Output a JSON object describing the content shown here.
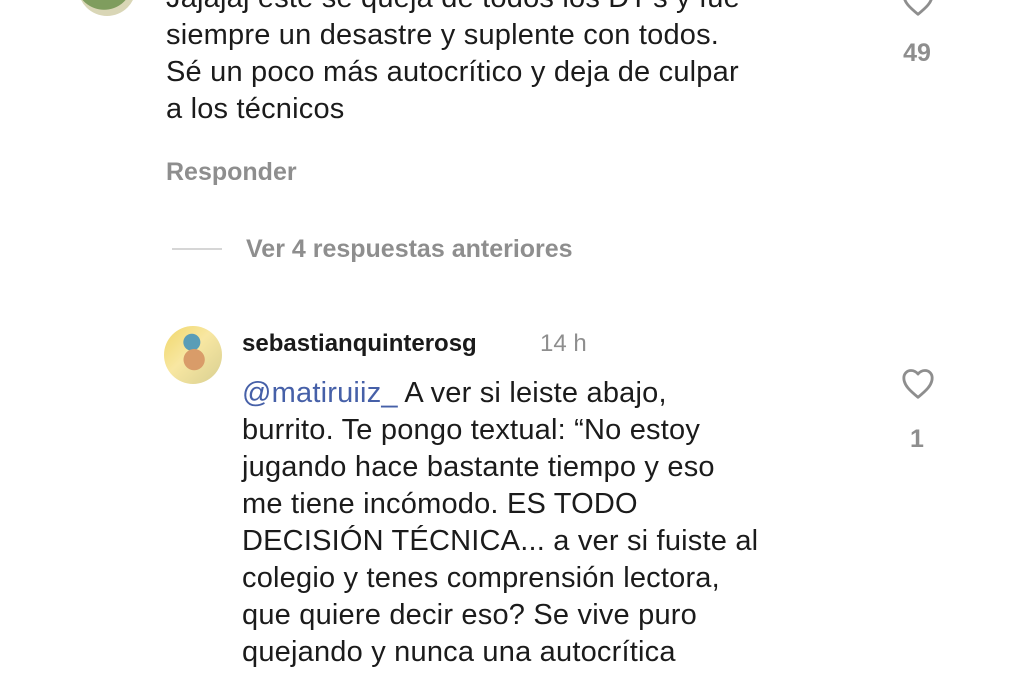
{
  "comment_top": {
    "text": "Jajajaj este se queja de todos los DT's y fue\nsiempre un desastre y suplente con todos.\nSé un poco más autocrítico y deja de culpar\na los técnicos",
    "like_count": "49",
    "reply_label": "Responder",
    "avatar_icon": "profile-avatar"
  },
  "replies": {
    "view_previous_label": "Ver 4 respuestas anteriores"
  },
  "comment_second": {
    "username": "sebastianquinterosg",
    "time": "14 h",
    "mention": "@matiruiiz_",
    "text": "  A ver si leiste abajo,\nburrito. Te pongo textual: “No estoy\njugando hace bastante tiempo y eso\nme tiene incómodo. ES TODO\nDECISIÓN TÉCNICA... a ver si fuiste al\ncolegio y tenes comprensión lectora,\nque quiere decir eso? Se vive puro\nquejando y nunca una autocrítica",
    "like_count": "1",
    "avatar_icon": "profile-avatar"
  },
  "icons": {
    "like": "heart-outline-icon"
  },
  "colors": {
    "text": "#1b1b1b",
    "secondary_text": "#8e8e8e",
    "mention": "#4660a8",
    "divider": "#d6d6d6"
  }
}
